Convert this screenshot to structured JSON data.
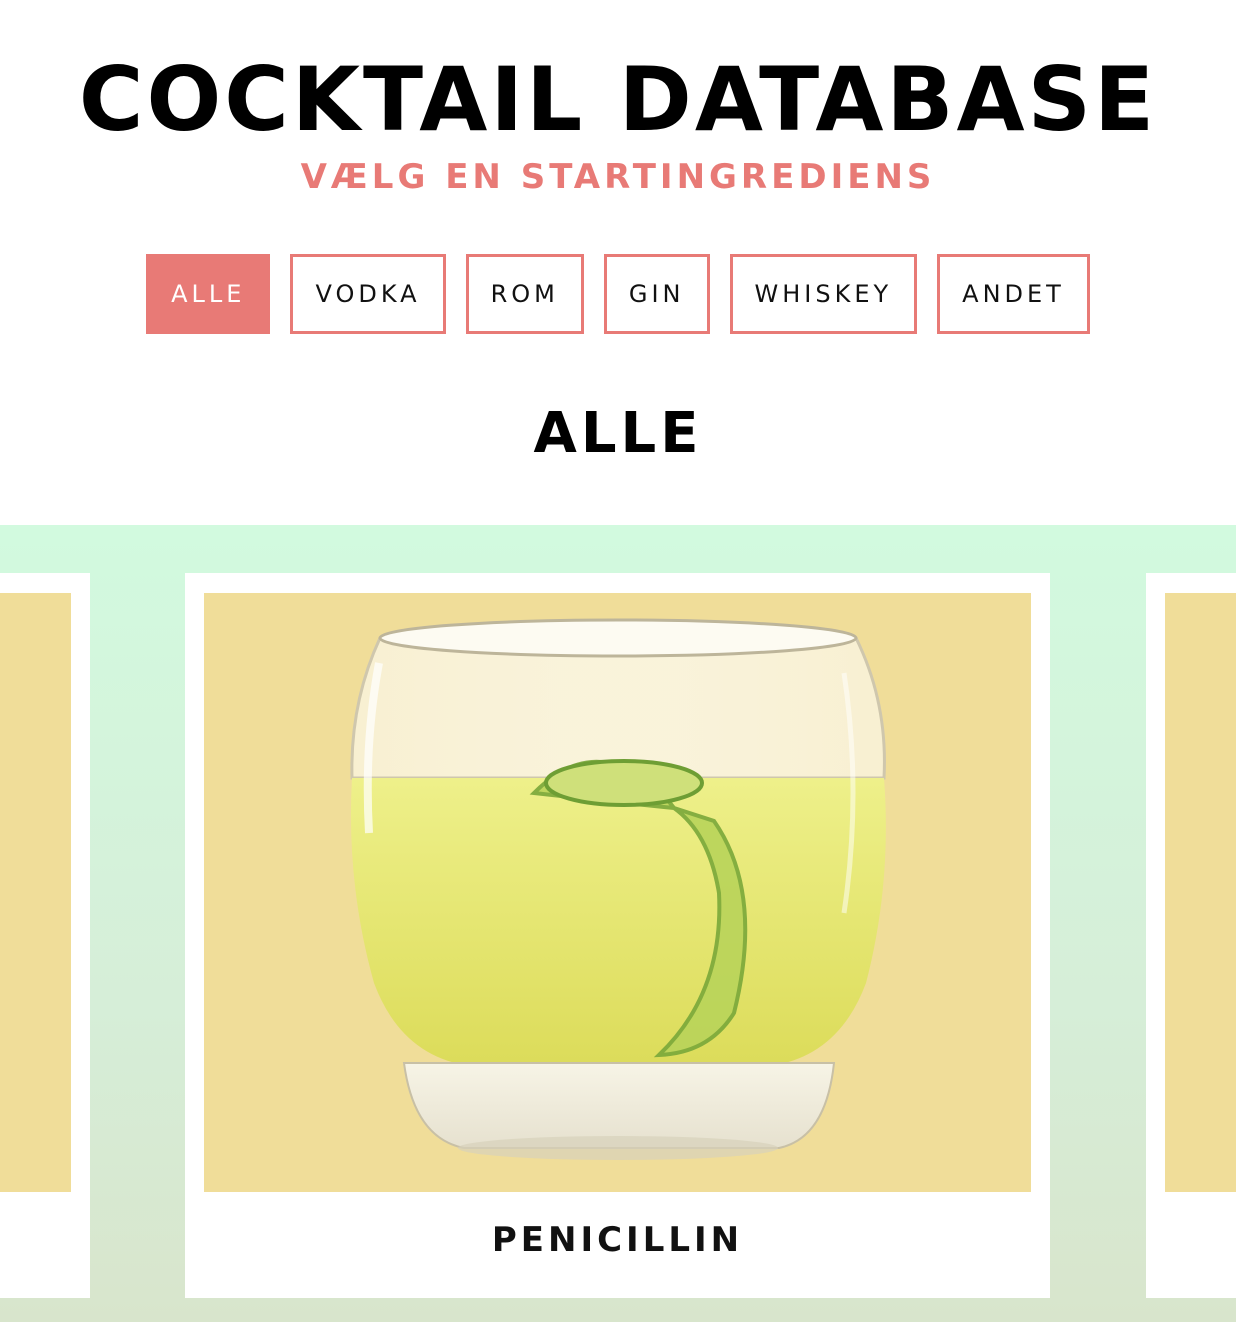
{
  "header": {
    "title": "COCKTAIL DATABASE",
    "subtitle": "VÆLG EN STARTINGREDIENS"
  },
  "filters": [
    {
      "label": "ALLE",
      "active": true
    },
    {
      "label": "VODKA",
      "active": false
    },
    {
      "label": "ROM",
      "active": false
    },
    {
      "label": "GIN",
      "active": false
    },
    {
      "label": "WHISKEY",
      "active": false
    },
    {
      "label": "ANDET",
      "active": false
    }
  ],
  "section": {
    "title": "ALLE"
  },
  "carousel": {
    "cards": [
      {
        "name": "PENICILLIN",
        "image": "cocktail-glass-with-lime"
      }
    ]
  },
  "colors": {
    "accent": "#e87a76",
    "card_image_bg": "#f0dd99",
    "carousel_bg_top": "#d2fadf",
    "carousel_bg_bottom": "#d8e5cc"
  }
}
